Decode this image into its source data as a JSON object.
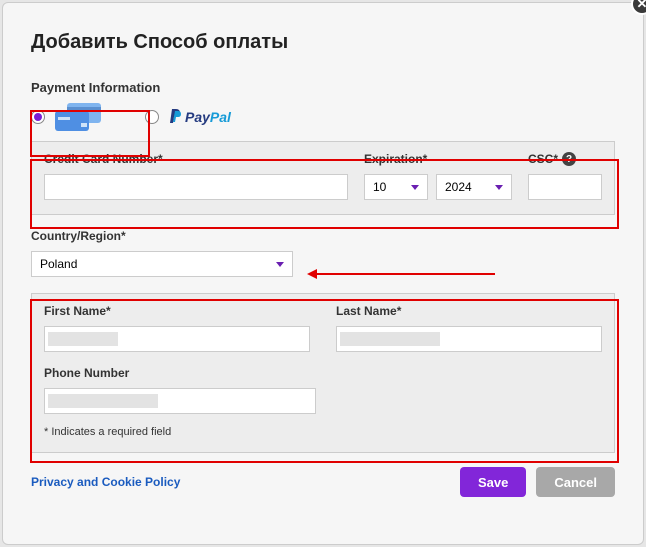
{
  "modal": {
    "title": "Добавить Способ оплаты",
    "close_label": "✕"
  },
  "section": {
    "heading": "Payment Information"
  },
  "methods": {
    "card_selected": true,
    "paypal_label": "PayPal"
  },
  "card_panel": {
    "cc_label": "Credit Card Number*",
    "cc_value": "",
    "exp_label": "Expiration*",
    "exp_month": "10",
    "exp_year": "2024",
    "csc_label": "CSC*",
    "csc_value": ""
  },
  "region": {
    "label": "Country/Region*",
    "value": "Poland"
  },
  "person_panel": {
    "first_name_label": "First Name*",
    "first_name_value": "",
    "last_name_label": "Last Name*",
    "last_name_value": "",
    "phone_label": "Phone Number",
    "phone_value": "",
    "note": "* Indicates a required field"
  },
  "footer": {
    "policy_link": "Privacy and Cookie Policy",
    "save_label": "Save",
    "cancel_label": "Cancel"
  }
}
